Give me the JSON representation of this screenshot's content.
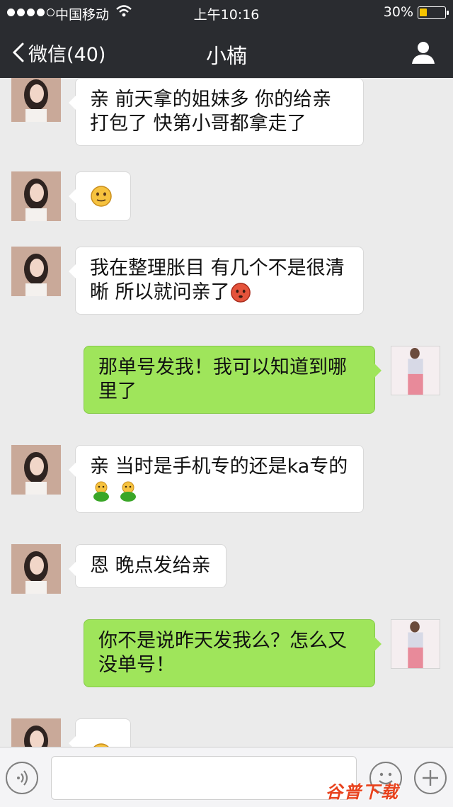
{
  "status_bar": {
    "carrier": "中国移动",
    "time": "上午10:16",
    "battery_percent": "30%",
    "battery_level": 0.3,
    "signal_bars": 4,
    "signal_total": 5
  },
  "nav": {
    "back_label": "微信(40)",
    "title": "小楠",
    "profile_icon": "person-icon"
  },
  "messages": [
    {
      "side": "in",
      "lines": [
        "亲  前天拿的姐妹多 你的给亲",
        "打包了  快第小哥都拿走了"
      ]
    },
    {
      "side": "in",
      "emoji": [
        "smile-emoji"
      ]
    },
    {
      "side": "in",
      "lines": [
        "我在整理胀目 有几个不是很清",
        "晰 所以就问亲了"
      ],
      "trailing_emoji": "blush-emoji"
    },
    {
      "side": "out",
      "lines": [
        "那单号发我！我可以知道到哪",
        "里了"
      ]
    },
    {
      "side": "in",
      "lines": [
        "亲 当时是手机专的还是ka专的"
      ],
      "emoji": [
        "green-figure-emoji",
        "green-figure-emoji"
      ]
    },
    {
      "side": "in",
      "lines": [
        "恩 晚点发给亲"
      ]
    },
    {
      "side": "out",
      "lines": [
        "你不是说昨天发我么？怎么又",
        "没单号！"
      ]
    },
    {
      "side": "in",
      "emoji": [
        "grin-emoji"
      ]
    }
  ],
  "input_bar": {
    "placeholder": "",
    "voice_icon": "voice-icon",
    "emoji_icon": "emoji-icon",
    "plus_icon": "plus-icon"
  },
  "watermark": "谷普下载",
  "colors": {
    "header_bg": "#2a2c30",
    "chat_bg": "#ebebeb",
    "outgoing_bubble": "#9fe55b",
    "incoming_bubble": "#ffffff",
    "battery_fill": "#f5c400"
  }
}
